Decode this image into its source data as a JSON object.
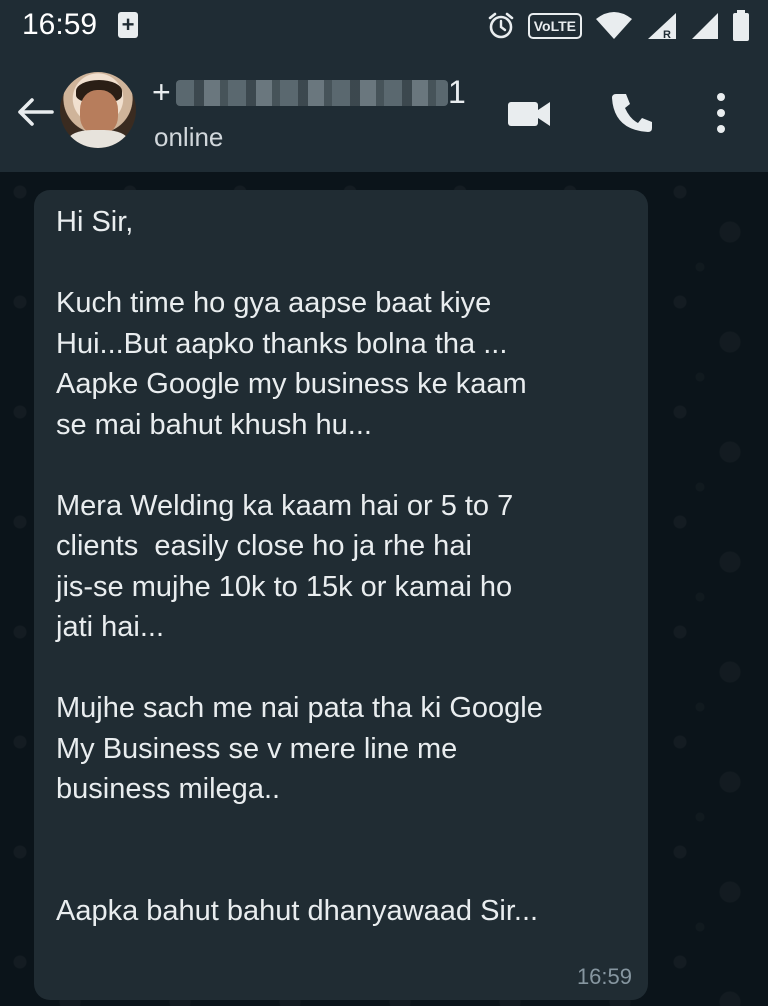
{
  "status_bar": {
    "time": "16:59",
    "network_label": "VoLTE",
    "icons": [
      "notification-plus-icon",
      "alarm-icon",
      "volte-icon",
      "wifi-icon",
      "signal-roaming-icon",
      "signal-icon",
      "battery-icon"
    ]
  },
  "header": {
    "contact_prefix": "+",
    "contact_suffix": "1",
    "status": "online",
    "icons": [
      "back-arrow-icon",
      "video-call-icon",
      "voice-call-icon",
      "more-options-icon"
    ]
  },
  "message": {
    "text": "Hi Sir,\n\nKuch time ho gya aapse baat kiye\nHui...But aapko thanks bolna tha ...\nAapke Google my business ke kaam\nse mai bahut khush hu...\n\nMera Welding ka kaam hai or 5 to 7\nclients  easily close ho ja rhe hai\njis-se mujhe 10k to 15k or kamai ho\njati hai...\n\nMujhe sach me nai pata tha ki Google\nMy Business se v mere line me\nbusiness milega..\n\n\nAapka bahut bahut dhanyawaad Sir...",
    "time": "16:59"
  },
  "colors": {
    "header_bg": "#1f2c34",
    "chat_bg": "#0b141a",
    "bubble_bg": "#202c33",
    "text_primary": "#e9edef",
    "text_secondary": "#8696a0"
  }
}
